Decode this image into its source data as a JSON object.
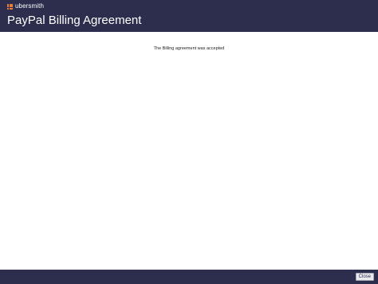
{
  "header": {
    "brand": "ubersmith",
    "title": "PayPal Billing Agreement"
  },
  "main": {
    "message": "The Billing agreement was accepted"
  },
  "footer": {
    "close_label": "Close"
  },
  "colors": {
    "header_bg": "#2d2d4e",
    "logo_accent": "#e87d3e"
  },
  "icons": {
    "brand_logo": "ubersmith-logo-icon"
  }
}
